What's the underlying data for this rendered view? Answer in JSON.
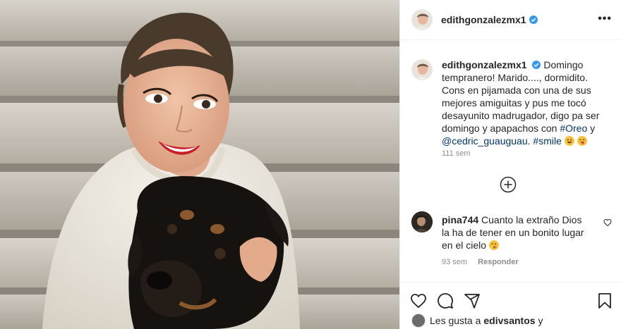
{
  "post": {
    "author": {
      "username": "edithgonzalezmx1",
      "verified": true,
      "avatar_icon": "profile-avatar"
    },
    "more_icon": "more-options-icon",
    "more_label": "•••",
    "caption": {
      "text_part1": "Domingo tempranero! Marido...., dormidito. Cons en pijamada con una de sus mejores amiguitas y pus me tocó desayunito madrugador, digo pa ser domingo y apapachos con ",
      "hashtag_oreo": "#Oreo",
      "text_part2": " y ",
      "mention": "@cedric_guauguau",
      "text_part3": ". ",
      "hashtag_smile": "#smile",
      "time": "111 sem"
    },
    "load_more_icon": "plus-circle-icon",
    "comments": [
      {
        "username": "pina744",
        "text": "Cuanto la extraño Dios la ha de tener en un bonito lugar en el cielo",
        "time": "93 sem",
        "reply_label": "Responder"
      }
    ],
    "actions": {
      "like": "heart-icon",
      "comment": "comment-icon",
      "share": "share-icon",
      "save": "bookmark-icon"
    },
    "likes": {
      "prefix": "Les gusta a",
      "user": "edivsantos",
      "suffix_visible": "y"
    },
    "colors": {
      "verified_blue": "#3897f0",
      "link": "#00376b",
      "meta_gray": "#8e8e8e",
      "lipstick": "#c81e28"
    }
  }
}
